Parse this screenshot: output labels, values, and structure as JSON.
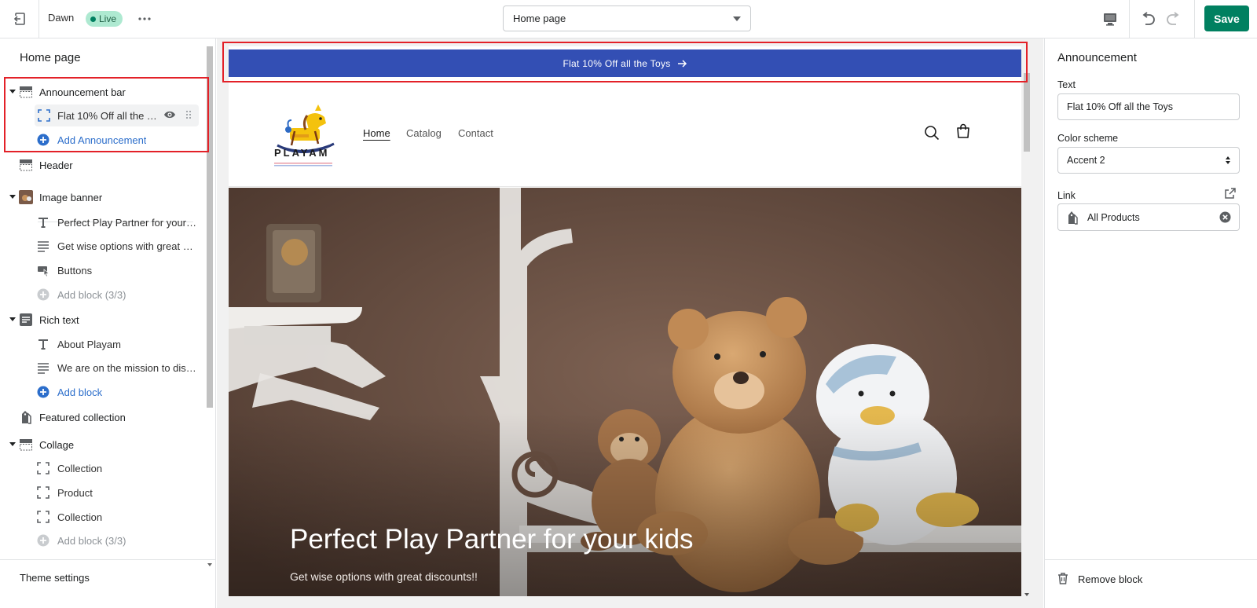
{
  "topbar": {
    "theme_name": "Dawn",
    "live_badge": "Live",
    "page_select": "Home page",
    "save_label": "Save"
  },
  "sidebar": {
    "title": "Home page",
    "sections": {
      "announcement_bar": {
        "label": "Announcement bar",
        "block_label": "Flat 10% Off all the Toys",
        "add_label": "Add Announcement"
      },
      "header": {
        "label": "Header"
      },
      "image_banner": {
        "label": "Image banner",
        "blocks": [
          "Perfect Play Partner for your kids",
          "Get wise options with great discounts!!",
          "Buttons"
        ],
        "add_label": "Add block (3/3)"
      },
      "rich_text": {
        "label": "Rich text",
        "blocks": [
          "About Playam",
          "We are on the mission to discover the best toys"
        ],
        "add_label": "Add block"
      },
      "featured_collection": {
        "label": "Featured collection"
      },
      "collage": {
        "label": "Collage",
        "blocks": [
          "Collection",
          "Product",
          "Collection"
        ],
        "add_label": "Add block (3/3)"
      }
    },
    "theme_settings": "Theme settings"
  },
  "preview": {
    "announcement_text": "Flat 10% Off all the Toys",
    "logo_text": "PLAYAM",
    "nav": [
      "Home",
      "Catalog",
      "Contact"
    ],
    "banner_title": "Perfect Play Partner for your kids",
    "banner_subtitle": "Get wise options with great discounts!!"
  },
  "inspector": {
    "title": "Announcement",
    "text_label": "Text",
    "text_value": "Flat 10% Off all the Toys",
    "color_scheme_label": "Color scheme",
    "color_scheme_value": "Accent 2",
    "link_label": "Link",
    "link_value": "All Products",
    "remove_label": "Remove block"
  },
  "colors": {
    "accent_green": "#008060",
    "announcement_blue": "#334fb4",
    "link_blue": "#2c6ecb",
    "highlight_red": "#e32128"
  }
}
